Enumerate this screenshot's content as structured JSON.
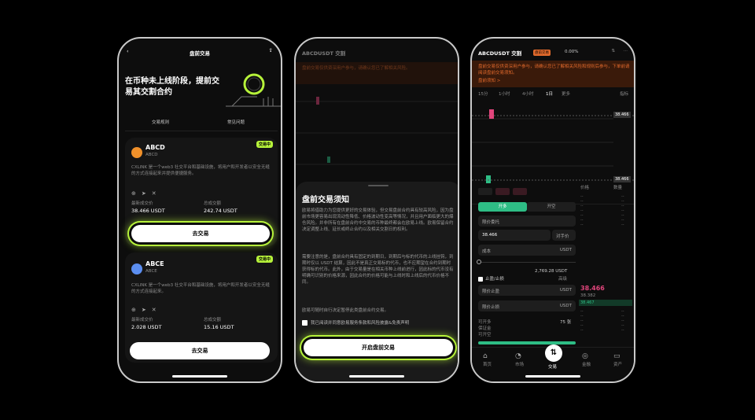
{
  "p1": {
    "nav_title": "盘前交易",
    "hero": "在币种未上线阶段，提前交易其交割合约",
    "tabs": [
      "交易规则",
      "常见问题"
    ],
    "cards": [
      {
        "badge": "交易中",
        "name": "ABCD",
        "sub": "ABCD",
        "desc": "CXLINK 是一个web3 社交平台和基础设施，将用户和开发者以安全无缝的方式连接起来并提供便捷服务。",
        "stat1_label": "最新成交价",
        "stat1": "38.466 USDT",
        "stat2_label": "总成交额",
        "stat2": "242.74 USDT",
        "btn": "去交易"
      },
      {
        "badge": "交易中",
        "name": "ABCE",
        "sub": "ABCE",
        "desc": "CXLINK 是一个web3 社交平台和基础设施，将用户和开发者以安全无缝的方式连接起来。",
        "stat1_label": "最新成交价",
        "stat1": "2.028 USDT",
        "stat2_label": "总成交额",
        "stat2": "15.16 USDT",
        "btn": "去交易"
      }
    ],
    "colors": {
      "accent": "#b6f23a",
      "btc": "#f0902a",
      "eth": "#5b8ef0"
    }
  },
  "p2": {
    "pair": "ABCDUSDT 交割",
    "banner": "盘前交易仅供资深用户参与，请确认您已了解相关风险。",
    "sheet_title": "盘前交易须知",
    "para1": "欧易将借助力为您提供更好的交易体验，但交易盘前合约具有较高风险，因为盘前市场更容易出现流动性降低、价格波动性变高等情况，并且用户面临更大的爆仓风险。并非所有在盘前合约中交易的币种最终都会在欧易上线。欧易保留合约决定调整上线、延长或终止合约以及相关交割日的权利。",
    "para2": "需要注意的是，盘前合约具有固定的到期日，到期后与标的代币的上线挂钩，到期时仅以 USDT 结算，因此不是真正交易标的代币，也不应期望在合约到期时获得标的代币。此外，由于交易量是在相关币种上线前进行，因此标的代币没有明确可识别的价格来源，因此合约的价格可能与上线时和上线后的代币价格不同。",
    "para3": "欧易可随时自行决定暂停此类盘前合约交易。",
    "agree": "我已阅读并同意欧易服务条款和风险披露&免责声明",
    "btn": "开启盘前交易"
  },
  "p3": {
    "pair": "ABCDUSDT 交割",
    "tag": "盘前交易",
    "change": "0.00%",
    "banner": "盘前交易仅供资深用户参与，请确认您已了解相关风险和规则后参与，下单前请阅读盘前交易须知。",
    "banner_link": "盘前须知 >",
    "tabs": [
      "15分",
      "1小时",
      "4小时",
      "1日",
      "更多"
    ],
    "chart_label": "指标",
    "price_tags": [
      "38.466",
      "38.466"
    ],
    "buy": "开多",
    "sell": "开空",
    "order_type": "限价委托",
    "price_val": "38.466",
    "opp": "对手价",
    "qty": "成本",
    "unit": "USDT",
    "avail": "2,769.28 USDT",
    "tpsl": "止盈/止损",
    "advanced": "高级",
    "tp": "限价止盈",
    "sl": "限价止损",
    "mark_price": "38.466",
    "mark_sub": "38.382",
    "ob_head": [
      "价格",
      "数量"
    ],
    "last_row": "38.467",
    "stat_labels": [
      "可开多",
      "保证金",
      "可开空"
    ],
    "stat_val": "75 张",
    "nav": [
      "首页",
      "市场",
      "交易",
      "金融",
      "资产"
    ]
  }
}
